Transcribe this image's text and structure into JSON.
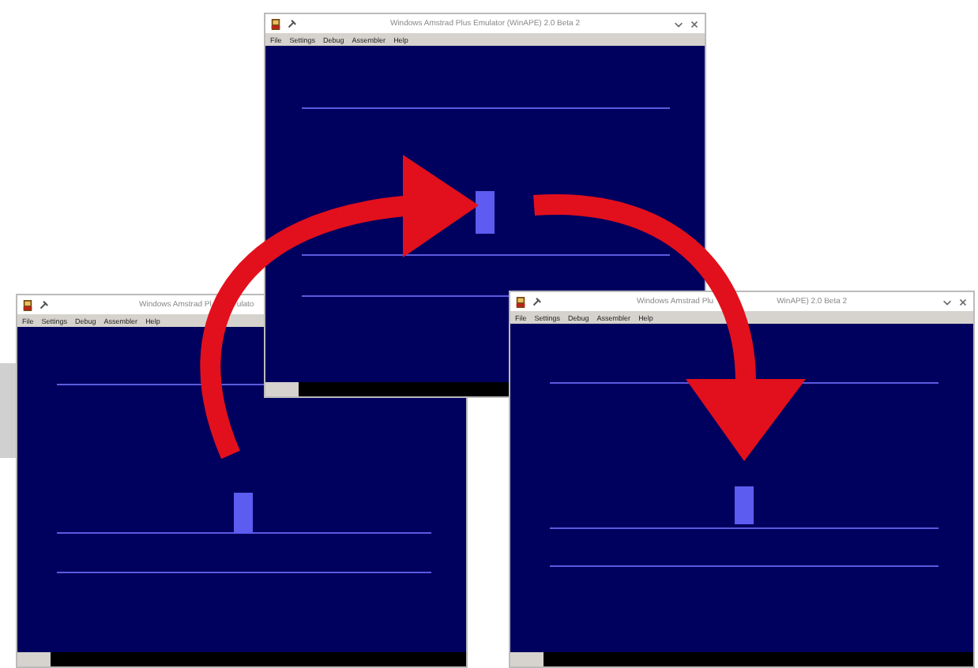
{
  "windows": [
    {
      "title": [
        "Windows Amstrad Pl",
        "ulato"
      ],
      "menu": [
        "File",
        "Settings",
        "Debug",
        "Assembler",
        "Help"
      ],
      "controls_shown": false
    },
    {
      "title": [
        "Windows Amstrad Plus Emulator (WinAPE) 2.0 Beta 2"
      ],
      "menu": [
        "File",
        "Settings",
        "Debug",
        "Assembler",
        "Help"
      ],
      "controls_shown": true
    },
    {
      "title": [
        "Windows Amstrad Plu",
        "WinAPE) 2.0 Beta 2"
      ],
      "menu": [
        "File",
        "Settings",
        "Debug",
        "Assembler",
        "Help"
      ],
      "controls_shown": true
    }
  ]
}
